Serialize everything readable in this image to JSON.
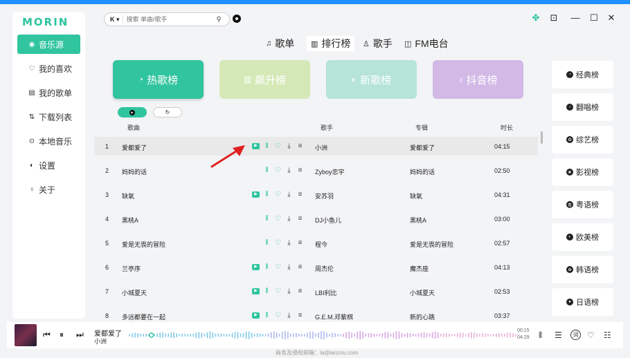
{
  "app": {
    "logo": "MORIN"
  },
  "sidebar": {
    "items": [
      {
        "label": "音乐源",
        "icon": "music-source-icon",
        "glyph": "◉",
        "active": true
      },
      {
        "label": "我的喜欢",
        "icon": "heart-icon",
        "glyph": "♡"
      },
      {
        "label": "我的歌单",
        "icon": "playlist-icon",
        "glyph": "▤"
      },
      {
        "label": "下载列表",
        "icon": "download-list-icon",
        "glyph": "⇅"
      },
      {
        "label": "本地音乐",
        "icon": "local-music-icon",
        "glyph": "⊙"
      },
      {
        "label": "设置",
        "icon": "settings-toggle-icon",
        "glyph": "◐"
      },
      {
        "label": "关于",
        "icon": "bulb-icon",
        "glyph": "♀"
      }
    ]
  },
  "search": {
    "source_label": "K ▾",
    "placeholder": "搜索 单曲/歌手"
  },
  "tabs": [
    {
      "label": "歌单",
      "glyph": "♫"
    },
    {
      "label": "排行榜",
      "glyph": "▥",
      "active": true
    },
    {
      "label": "歌手",
      "glyph": "♙"
    },
    {
      "label": "FM电台",
      "glyph": "◫"
    }
  ],
  "cards": [
    {
      "label": "热歌榜",
      "glyph": "◔",
      "color": "#30c49f"
    },
    {
      "label": "飙升榜",
      "glyph": "▥",
      "color": "#d5e9b8"
    },
    {
      "label": "新歌榜",
      "glyph": "◐",
      "color": "#b6e4d8"
    },
    {
      "label": "抖音榜",
      "glyph": "♪",
      "color": "#d3b9e6"
    }
  ],
  "pills": {
    "play_glyph": "▶",
    "refresh_glyph": "↻"
  },
  "table": {
    "headers": {
      "song": "歌曲",
      "artist": "歌手",
      "album": "专辑",
      "duration": "时长"
    },
    "rows": [
      {
        "num": "1",
        "title": "爱都爱了",
        "artist": "小洲",
        "album": "爱都爱了",
        "duration": "04:15",
        "mv": true,
        "highlight": true
      },
      {
        "num": "2",
        "title": "妈妈的话",
        "artist": "Zyboy忠宇",
        "album": "妈妈的话",
        "duration": "02:50",
        "mv": false
      },
      {
        "num": "3",
        "title": "缺氧",
        "artist": "安苏羽",
        "album": "缺氧",
        "duration": "04:31",
        "mv": true
      },
      {
        "num": "4",
        "title": "黑桃A",
        "artist": "DJ小鱼儿",
        "album": "黑桃A",
        "duration": "03:00",
        "mv": false
      },
      {
        "num": "5",
        "title": "爱是无畏的冒险",
        "artist": "程今",
        "album": "爱是无畏的冒险",
        "duration": "02:57",
        "mv": false
      },
      {
        "num": "6",
        "title": "兰亭序",
        "artist": "周杰伦",
        "album": "魔杰座",
        "duration": "04:13",
        "mv": true
      },
      {
        "num": "7",
        "title": "小城夏天",
        "artist": "LBI利比",
        "album": "小城夏天",
        "duration": "02:53",
        "mv": true
      },
      {
        "num": "8",
        "title": "多远都要在一起",
        "artist": "G.E.M.邓紫棋",
        "album": "新的心跳",
        "duration": "03:37",
        "mv": true
      }
    ]
  },
  "rankings": [
    {
      "label": "经典榜",
      "glyph": "◔"
    },
    {
      "label": "翻唱榜",
      "glyph": "♪"
    },
    {
      "label": "综艺榜",
      "glyph": "✪"
    },
    {
      "label": "影视榜",
      "glyph": "❀"
    },
    {
      "label": "粤语榜",
      "glyph": "粤"
    },
    {
      "label": "欧美榜",
      "glyph": "◐"
    },
    {
      "label": "韩语榜",
      "glyph": "✿"
    },
    {
      "label": "日语榜",
      "glyph": "●"
    }
  ],
  "player": {
    "title": "爱都爱了",
    "artist": "小洲",
    "time_current": "00:15",
    "time_total": "04:29",
    "progress": 0.06,
    "lyric_label": "词"
  },
  "footer": {
    "text": "商务及侵权邮箱：la@lanzou.com"
  },
  "colors": {
    "accent": "#30c49f",
    "annotation_arrow": "#e02020"
  }
}
